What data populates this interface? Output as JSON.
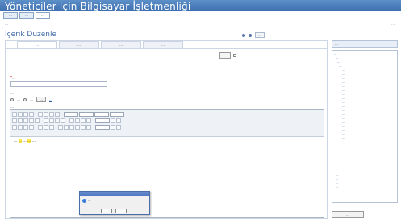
{
  "app": {
    "title": "Yöneticiler için Bilgisayar İşletmenliği",
    "user_info": "…"
  },
  "top_tabs": [
    {
      "label": "…"
    },
    {
      "label": "…"
    },
    {
      "label": "…"
    }
  ],
  "breadcrumb": "…",
  "breadcrumb_right": "…",
  "page_title": "İçerik Düzenle",
  "head_action": "…",
  "sub_tabs": [
    {
      "label": "…"
    },
    {
      "label": "…"
    },
    {
      "label": "…"
    },
    {
      "label": "…"
    }
  ],
  "save": {
    "button": "…",
    "note": "…"
  },
  "form": {
    "title_label": "…",
    "title_value": "…",
    "options_label": "…",
    "radio_a": "…",
    "radio_b": "…",
    "choose_btn": "…",
    "link": "…",
    "editor_label": "…"
  },
  "editor": {
    "line1": "…",
    "para2_a": "…",
    "para2_hl1": "…",
    "para2_mid": "…",
    "para2_hl2": "…",
    "para2_end": "…"
  },
  "dialog": {
    "text": "…"
  },
  "sidebar": {
    "header": "…",
    "tree": [
      "…",
      "…",
      "…",
      "…",
      "…",
      "…",
      "…",
      "…",
      "…",
      "…",
      "…",
      "…",
      "…",
      "…",
      "…",
      "…",
      "…",
      "…",
      "…",
      "…",
      "…",
      "…",
      "…",
      "…",
      "…",
      "…",
      "…",
      "…",
      "…",
      "…",
      "…",
      "…",
      "…",
      "…"
    ],
    "footer_button": "…"
  }
}
